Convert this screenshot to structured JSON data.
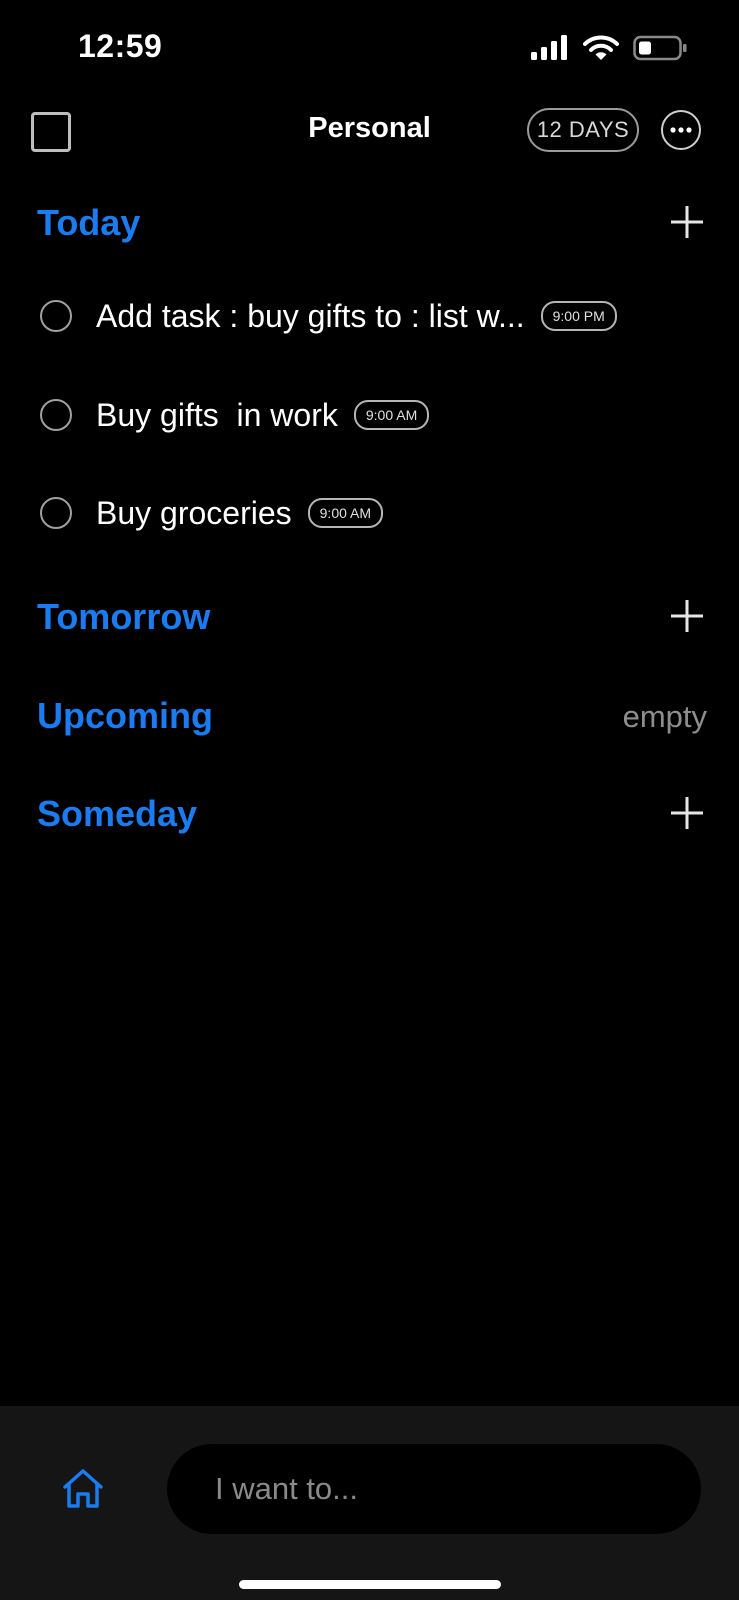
{
  "status_bar": {
    "time": "12:59",
    "signal_icon": "signal-icon",
    "wifi_icon": "wifi-icon",
    "battery_icon": "battery-icon"
  },
  "header": {
    "title": "Personal",
    "days_badge": "12 DAYS",
    "select_icon": "square-checkbox-icon",
    "more_icon": "ellipsis-circle-icon"
  },
  "sections": {
    "today": {
      "title": "Today",
      "tasks": [
        {
          "title": "Add task : buy gifts to : list w...",
          "time": "9:00 PM"
        },
        {
          "title": "Buy gifts  in work",
          "time": "9:00 AM"
        },
        {
          "title": "Buy groceries",
          "time": "9:00 AM"
        }
      ]
    },
    "tomorrow": {
      "title": "Tomorrow"
    },
    "upcoming": {
      "title": "Upcoming",
      "status": "empty"
    },
    "someday": {
      "title": "Someday"
    }
  },
  "bottom_bar": {
    "home_icon": "home-icon",
    "input_placeholder": "I want to..."
  },
  "colors": {
    "background": "#000000",
    "accent": "#1a7cf0",
    "bottom_bar": "#151515",
    "muted_text": "#8e8e8e"
  }
}
